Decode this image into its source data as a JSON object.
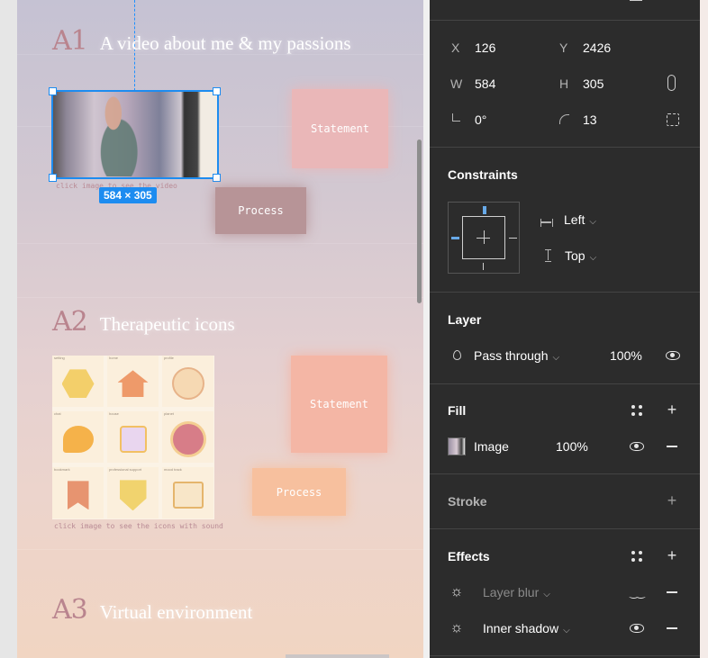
{
  "canvas": {
    "sections": [
      {
        "num": "A1",
        "title": "A video about me & my passions"
      },
      {
        "num": "A2",
        "title": "Therapeutic icons"
      },
      {
        "num": "A3",
        "title": "Virtual environment"
      }
    ],
    "video_caption": "click image to see the video",
    "size_badge": "584 × 305",
    "icons_caption": "click image to see the icons with sound",
    "cards": {
      "statement": "Statement",
      "process": "Process"
    },
    "icon_tiles": [
      {
        "label": "setting",
        "icon": "hexagon-icon"
      },
      {
        "label": "home",
        "icon": "house-icon"
      },
      {
        "label": "profile",
        "icon": "profile-icon"
      },
      {
        "label": "chat",
        "icon": "chat-icon"
      },
      {
        "label": "house",
        "icon": "phone-icon"
      },
      {
        "label": "planet",
        "icon": "planet-icon"
      },
      {
        "label": "bookmark",
        "icon": "bookmark-icon"
      },
      {
        "label": "professional support",
        "icon": "shield-icon"
      },
      {
        "label": "mood track",
        "icon": "calendar-icon"
      }
    ]
  },
  "panel": {
    "geometry": {
      "x_label": "X",
      "x_value": "126",
      "y_label": "Y",
      "y_value": "2426",
      "w_label": "W",
      "w_value": "584",
      "h_label": "H",
      "h_value": "305",
      "rotation_value": "0°",
      "radius_value": "13"
    },
    "constraints": {
      "title": "Constraints",
      "horizontal": "Left",
      "vertical": "Top"
    },
    "layer": {
      "title": "Layer",
      "blend_mode": "Pass through",
      "opacity": "100%"
    },
    "fill": {
      "title": "Fill",
      "type": "Image",
      "opacity": "100%"
    },
    "stroke": {
      "title": "Stroke"
    },
    "effects": {
      "title": "Effects",
      "items": [
        {
          "name": "Layer blur",
          "visible": false
        },
        {
          "name": "Inner shadow",
          "visible": true
        }
      ]
    }
  },
  "colors": {
    "selection": "#1d8cf0",
    "panel_bg": "#2c2c2c",
    "statement_pink": "#eab7b8",
    "process_mauve": "#b79497",
    "statement_peach": "#f4b6a5",
    "process_orange": "#f7c09e"
  }
}
